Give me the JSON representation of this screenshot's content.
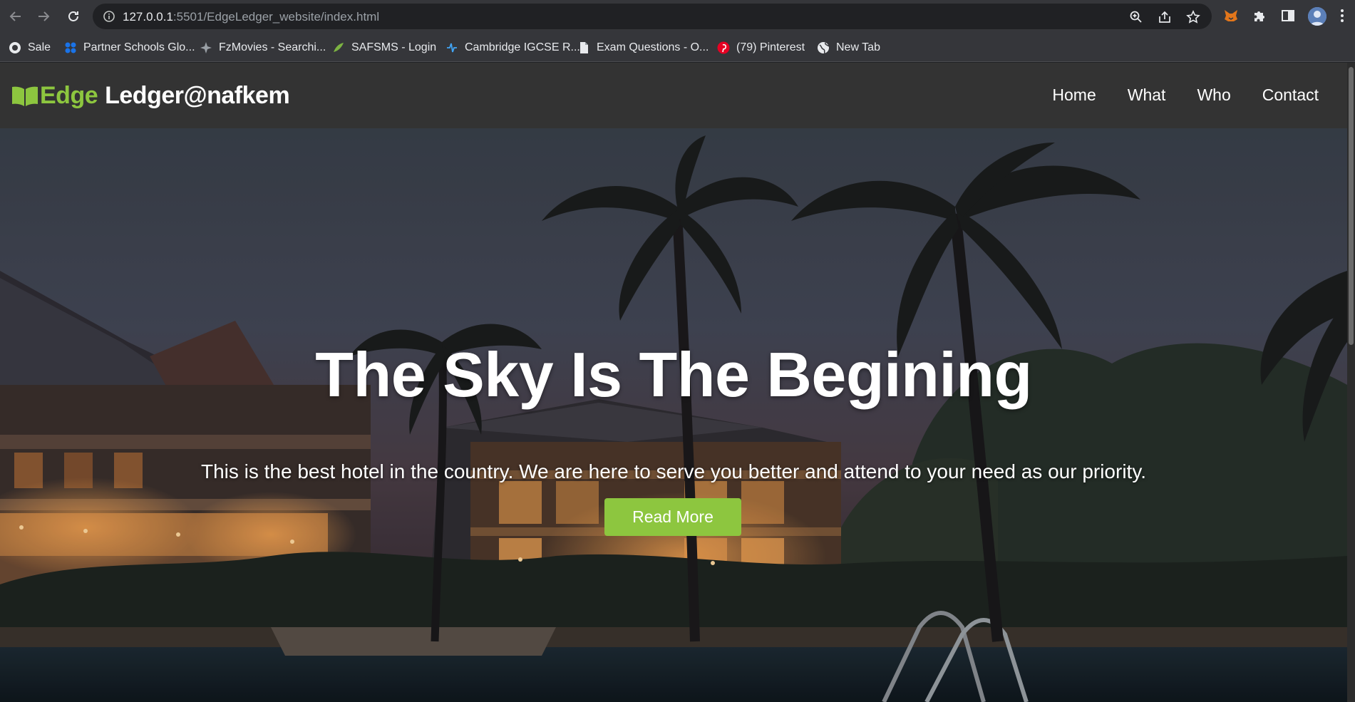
{
  "browser": {
    "url_host": "127.0.0.1",
    "url_path": ":5501/EdgeLedger_website/index.html",
    "bookmarks": [
      {
        "label": "Sale",
        "icon": "sale-icon"
      },
      {
        "label": "Partner Schools Glo...",
        "icon": "partner-schools-icon"
      },
      {
        "label": "FzMovies - Searchi...",
        "icon": "fzmovies-icon"
      },
      {
        "label": "SAFSMS - Login",
        "icon": "safsms-icon"
      },
      {
        "label": "Cambridge IGCSE R...",
        "icon": "cambridge-icon"
      },
      {
        "label": "Exam Questions - O...",
        "icon": "document-icon"
      },
      {
        "label": "(79) Pinterest",
        "icon": "pinterest-icon"
      },
      {
        "label": "New Tab",
        "icon": "globe-icon"
      }
    ]
  },
  "site": {
    "logo_edge": "Edge",
    "logo_rest": "Ledger@nafkem",
    "nav": [
      "Home",
      "What",
      "Who",
      "Contact"
    ]
  },
  "hero": {
    "title": "The Sky Is The Begining",
    "text": "This is the best hotel in the country. We are here to serve you better and attend to your need as our priority.",
    "button_label": "Read More"
  },
  "colors": {
    "accent": "#8dc63f",
    "header_bg": "#333333",
    "chrome_bg": "#35363a"
  }
}
